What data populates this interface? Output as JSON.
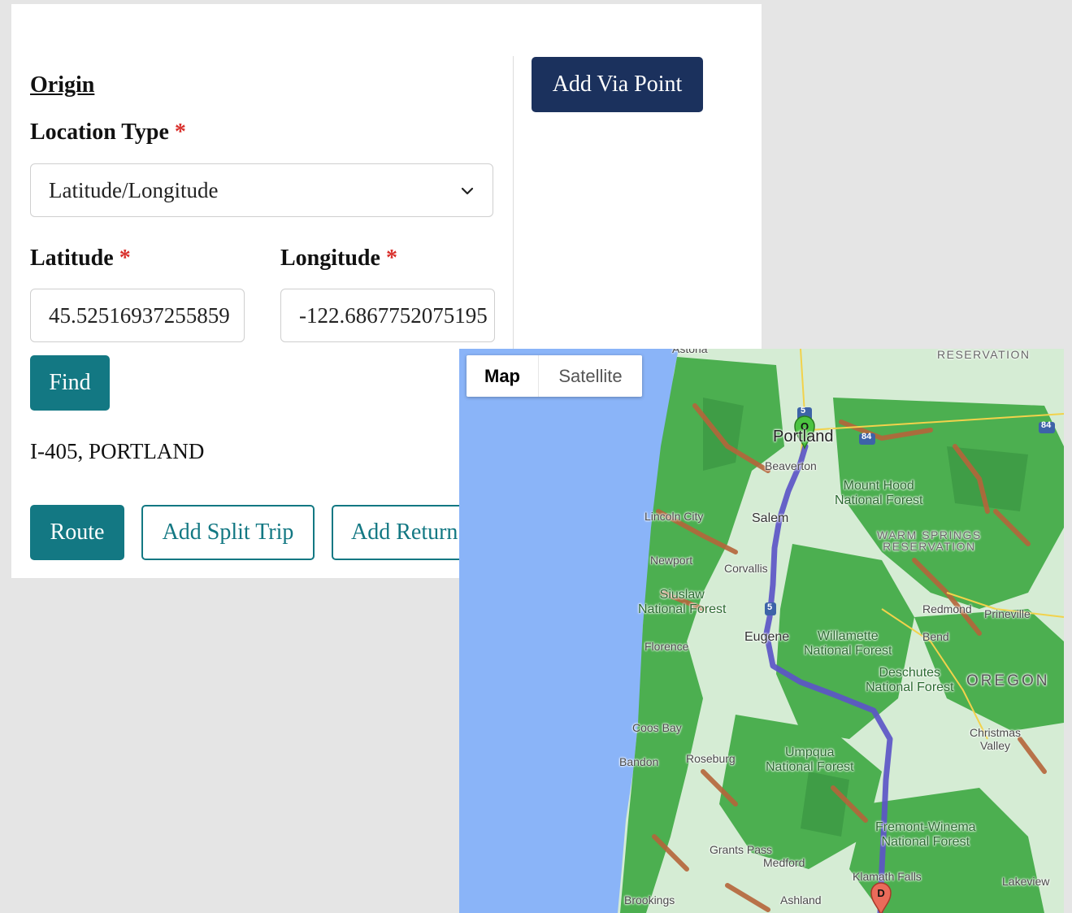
{
  "form": {
    "origin_title": "Origin",
    "location_type_label": "Location Type",
    "required_mark": "*",
    "location_type_value": "Latitude/Longitude",
    "latitude_label": "Latitude",
    "longitude_label": "Longitude",
    "latitude_value": "45.52516937255859",
    "longitude_value": "-122.6867752075195",
    "find_label": "Find",
    "address_text": "I-405, PORTLAND",
    "route_label": "Route",
    "add_split_trip_label": "Add Split Trip",
    "add_return_label": "Add Return",
    "add_via_point_label": "Add Via Point"
  },
  "map": {
    "type_map_label": "Map",
    "type_satellite_label": "Satellite",
    "origin_marker_letter": "O",
    "destination_marker_letter": "D",
    "places": {
      "astoria": "Astoria",
      "reservation_top": "RESERVATION",
      "portland": "Portland",
      "beaverton": "Beaverton",
      "mount_hood": "Mount Hood\nNational Forest",
      "lincoln_city": "Lincoln City",
      "salem": "Salem",
      "warm_springs": "WARM SPRINGS\nRESERVATION",
      "newport": "Newport",
      "corvallis": "Corvallis",
      "siuslaw": "Siuslaw\nNational Forest",
      "redmond": "Redmond",
      "prineville": "Prineville",
      "eugene": "Eugene",
      "willamette": "Willamette\nNational Forest",
      "bend": "Bend",
      "florence": "Florence",
      "deschutes": "Deschutes\nNational Forest",
      "oregon": "OREGON",
      "coos_bay": "Coos Bay",
      "christmas_valley": "Christmas\nValley",
      "bandon": "Bandon",
      "roseburg": "Roseburg",
      "umpqua": "Umpqua\nNational Forest",
      "fremont": "Fremont-Winema\nNational Forest",
      "grants_pass": "Grants Pass",
      "medford": "Medford",
      "klamath_falls": "Klamath Falls",
      "lakeview": "Lakeview",
      "brookings": "Brookings",
      "ashland": "Ashland"
    },
    "shields": {
      "i5_top": "5",
      "i84_left": "84",
      "i84_right": "84",
      "i5_mid": "5"
    },
    "colors": {
      "water": "#8ab4f8",
      "forest": "#4caf50",
      "land": "#d5ecd4",
      "route": "#5c55c7",
      "traffic_slow": "#b5653a",
      "origin_marker": "#4cc441",
      "destination_marker": "#ea6b5a",
      "teal": "#137883",
      "navy": "#1b315d"
    }
  }
}
